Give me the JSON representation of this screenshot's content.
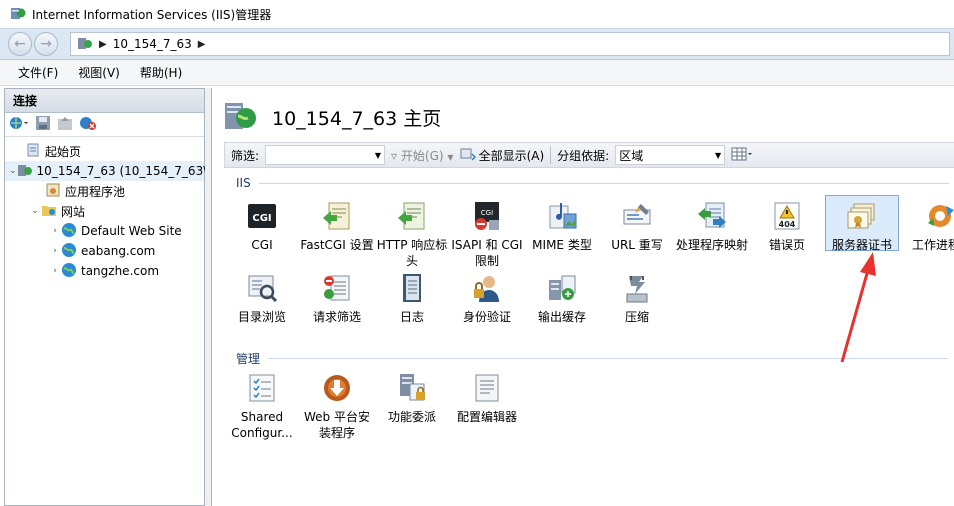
{
  "window": {
    "title": "Internet Information Services (IIS)管理器"
  },
  "address": {
    "server": "10_154_7_63"
  },
  "menu": [
    "文件(F)",
    "视图(V)",
    "帮助(H)"
  ],
  "connections": {
    "header": "连接",
    "tree": {
      "start": "起始页",
      "server": "10_154_7_63 (10_154_7_63\\",
      "apppools": "应用程序池",
      "sites": "网站",
      "site1": "Default Web Site",
      "site2": "eabang.com",
      "site3": "tangzhe.com"
    }
  },
  "main": {
    "title": "10_154_7_63 主页",
    "filter": {
      "label": "筛选:",
      "go": "开始(G)",
      "showall": "全部显示(A)",
      "groupby": "分组依据:",
      "groupvalue": "区域"
    },
    "sections": {
      "iis": "IIS",
      "manage": "管理"
    },
    "features": {
      "cgi": "CGI",
      "fastcgi": "FastCGI 设置",
      "http_headers": "HTTP 响应标头",
      "isapi": "ISAPI 和 CGI 限制",
      "mime": "MIME 类型",
      "url_rewrite": "URL 重写",
      "handlers": "处理程序映射",
      "errors": "错误页",
      "server_cert": "服务器证书",
      "worker": "工作进程",
      "dir_browse": "目录浏览",
      "req_filter": "请求筛选",
      "logging": "日志",
      "auth": "身份验证",
      "output_cache": "输出缓存",
      "compression": "压缩",
      "shared_config": "Shared Configur...",
      "web_pi": "Web 平台安装程序",
      "delegation": "功能委派",
      "config_editor": "配置编辑器"
    },
    "icon_text": {
      "cgi": "CGI",
      "errors": "404"
    }
  },
  "colors": {
    "accent": "#7ea9d8",
    "arrow": "#e8322d"
  }
}
